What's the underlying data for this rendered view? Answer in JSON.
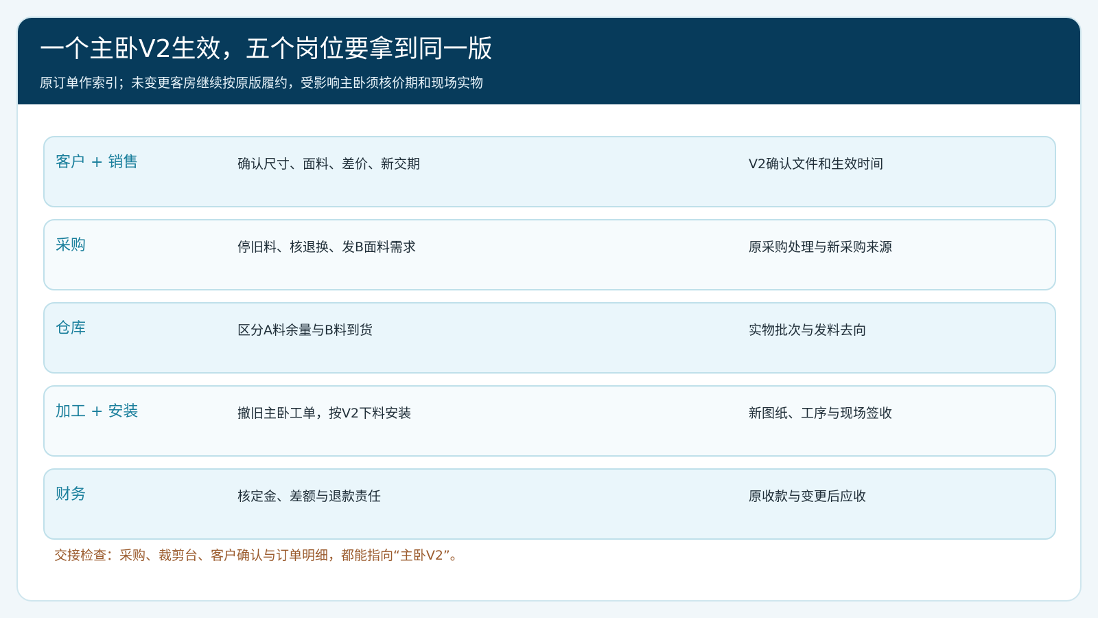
{
  "header": {
    "title": "一个主卧V2生效，五个岗位要拿到同一版",
    "subtitle": "原订单作索引；未变更客房继续按原版履约，受影响主卧须核价期和现场实物"
  },
  "rows": [
    {
      "role": "客户 + 销售",
      "task": "确认尺寸、面料、差价、新交期",
      "ref": "V2确认文件和生效时间"
    },
    {
      "role": "采购",
      "task": "停旧料、核退换、发B面料需求",
      "ref": "原采购处理与新采购来源"
    },
    {
      "role": "仓库",
      "task": "区分A料余量与B料到货",
      "ref": "实物批次与发料去向"
    },
    {
      "role": "加工 + 安装",
      "task": "撤旧主卧工单，按V2下料安装",
      "ref": "新图纸、工序与现场签收"
    },
    {
      "role": "财务",
      "task": "核定金、差额与退款责任",
      "ref": "原收款与变更后应收"
    }
  ],
  "footer": {
    "note": "交接检查：采购、裁剪台、客户确认与订单明细，都能指向“主卧V2”。"
  }
}
